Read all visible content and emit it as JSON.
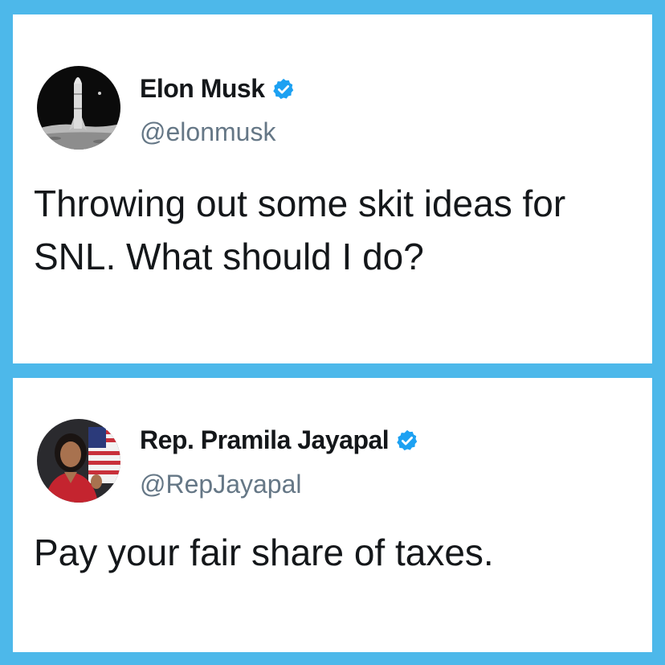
{
  "tweets": [
    {
      "display_name": "Elon Musk",
      "handle": "@elonmusk",
      "verified": true,
      "avatar_icon": "starship-rocket-on-moon",
      "text": "Throwing out some skit ideas for SNL. What should I do?"
    },
    {
      "display_name": "Rep. Pramila Jayapal",
      "handle": "@RepJayapal",
      "verified": true,
      "avatar_icon": "woman-with-american-flag",
      "text": "Pay your fair share of taxes."
    }
  ],
  "colors": {
    "background_frame": "#4db8ea",
    "card": "#ffffff",
    "verified_badge": "#1da1f2",
    "handle_gray": "#657786",
    "text_dark": "#14171a"
  }
}
